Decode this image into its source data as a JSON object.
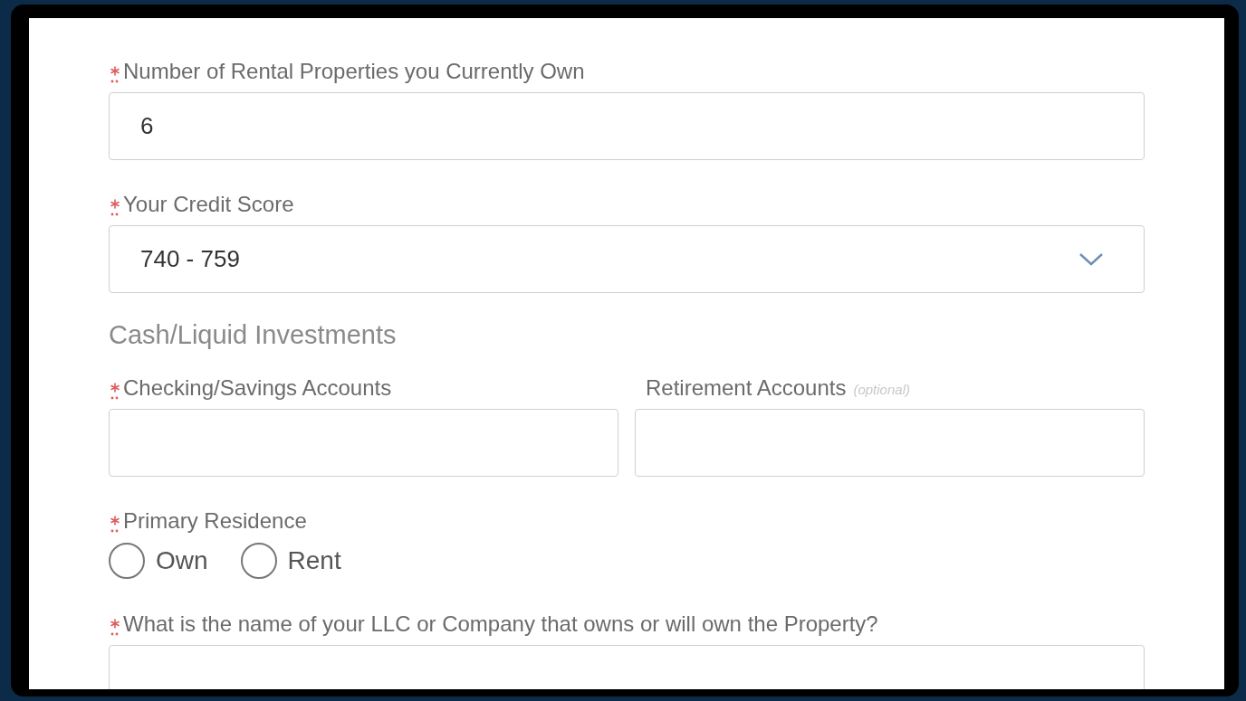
{
  "fields": [
    {
      "kind": "text",
      "label": "Number of Rental Properties you Currently Own",
      "required": true,
      "value": "6"
    },
    {
      "kind": "select",
      "label": "Your Credit Score",
      "required": true,
      "value": "740 - 759"
    },
    {
      "kind": "heading",
      "label": "Cash/Liquid Investments"
    },
    {
      "kind": "pair",
      "items": [
        {
          "label": "Checking/Savings Accounts",
          "required": true
        },
        {
          "label": "Retirement Accounts",
          "required": false,
          "hint": "(optional)"
        }
      ]
    },
    {
      "kind": "radio",
      "label": "Primary Residence",
      "required": true,
      "options": [
        {
          "label": "Own",
          "selected": false
        },
        {
          "label": "Rent",
          "selected": false
        }
      ]
    },
    {
      "kind": "text",
      "label": "What is the name of your LLC or Company that owns or will own the Property?",
      "required": true
    }
  ]
}
